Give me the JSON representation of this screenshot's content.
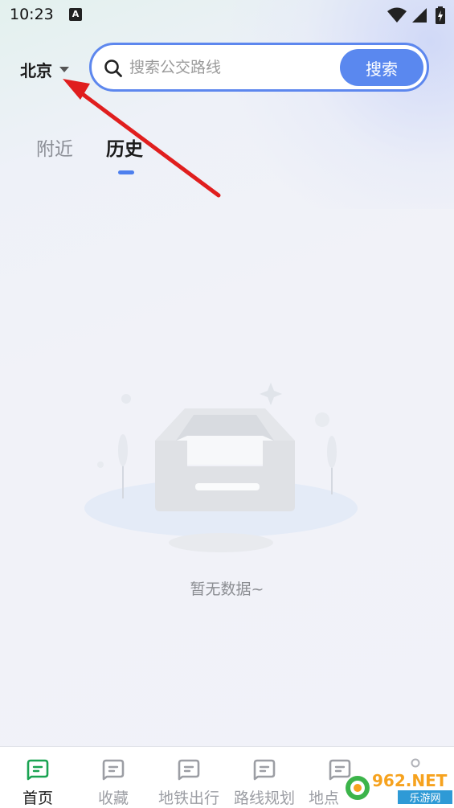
{
  "status_bar": {
    "time": "10:23",
    "notification_badge": "A",
    "icons": [
      "wifi-icon",
      "signal-icon",
      "battery-charging-icon"
    ]
  },
  "header": {
    "city": "北京",
    "search_placeholder": "搜索公交路线",
    "search_button": "搜索"
  },
  "tabs": [
    {
      "label": "附近",
      "active": false
    },
    {
      "label": "历史",
      "active": true
    }
  ],
  "empty_state": {
    "message": "暂无数据~",
    "icon": "empty-inbox-illustration"
  },
  "bottom_nav": [
    {
      "label": "首页",
      "icon": "home-icon",
      "active": true
    },
    {
      "label": "收藏",
      "icon": "favorites-icon",
      "active": false
    },
    {
      "label": "地铁出行",
      "icon": "subway-icon",
      "active": false
    },
    {
      "label": "路线规划",
      "icon": "route-icon",
      "active": false
    },
    {
      "label": "地点",
      "icon": "place-icon",
      "active": false
    }
  ],
  "watermark": {
    "main": "962.NET",
    "sub": "乐游网"
  },
  "colors": {
    "accent": "#5a88ef",
    "active_nav": "#27ae60",
    "annotation_arrow": "#e01e1e"
  }
}
